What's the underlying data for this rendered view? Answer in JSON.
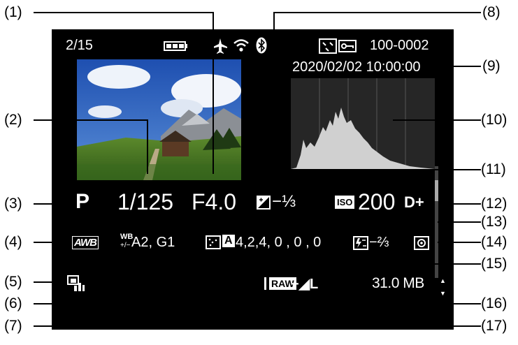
{
  "screen": {
    "image_number": "2/15",
    "folder_file": "100-0002",
    "datetime": "2020/02/02  10:00:00",
    "shooting_mode": "P",
    "shutter_speed": "1/125",
    "aperture": "F4.0",
    "exposure_comp": "−⅓",
    "iso_badge": "ISO",
    "iso": "200",
    "highlight_tone_priority": "D+",
    "white_balance": "AWB",
    "wb_correction": "A2, G1",
    "wb_icon_top": "WB",
    "wb_icon_bottom": "+/−",
    "picture_style_icon": "A",
    "picture_style_values": "4,2,4, 0 , 0 , 0",
    "flash_comp": "−⅔",
    "raw_badge": "RAW",
    "image_quality": "+◢L",
    "file_size": "31.0 MB"
  },
  "callouts": [
    "(1)",
    "(2)",
    "(3)",
    "(4)",
    "(5)",
    "(6)",
    "(7)",
    "(8)",
    "(9)",
    "(10)",
    "(11)",
    "(12)",
    "(13)",
    "(14)",
    "(15)",
    "(16)",
    "(17)"
  ],
  "colors": {
    "screen_bg": "#000000",
    "text": "#ffffff",
    "histogram": "#d0d0d0",
    "leader": "#000000"
  }
}
